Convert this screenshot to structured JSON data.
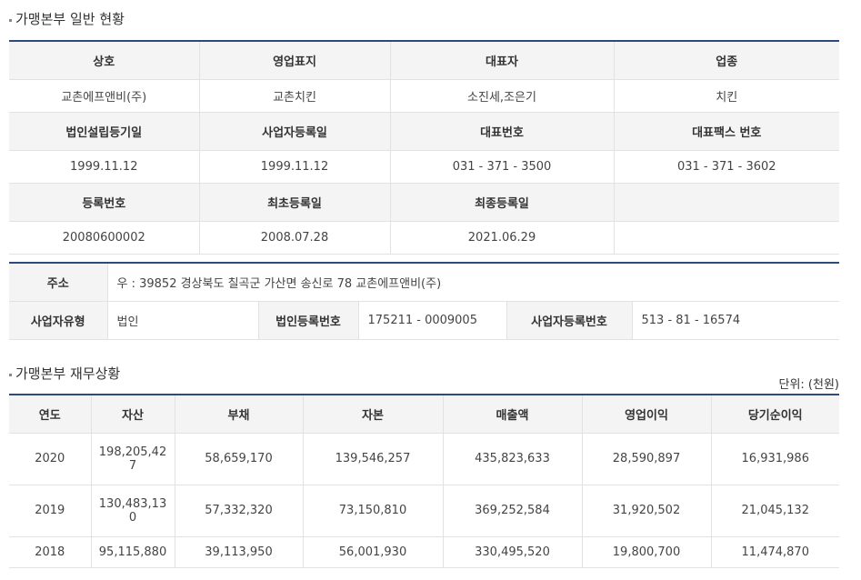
{
  "section1": {
    "title": "가맹본부 일반 현황",
    "row1_headers": [
      "상호",
      "영업표지",
      "대표자",
      "업종"
    ],
    "row1_values": [
      "교촌에프앤비(주)",
      "교촌치킨",
      "소진세,조은기",
      "치킨"
    ],
    "row2_headers": [
      "법인설립등기일",
      "사업자등록일",
      "대표번호",
      "대표팩스 번호"
    ],
    "row2_values": [
      "1999.11.12",
      "1999.11.12",
      "031 - 371 - 3500",
      "031 - 371 - 3602"
    ],
    "row3_headers": [
      "등록번호",
      "최초등록일",
      "최종등록일",
      ""
    ],
    "row3_values": [
      "20080600002",
      "2008.07.28",
      "2021.06.29",
      ""
    ]
  },
  "section2": {
    "address_label": "주소",
    "address_value": "우 : 39852 경상북도 칠곡군 가산면 송신로 78 교촌에프앤비(주)",
    "biztype_label": "사업자유형",
    "biztype_value": "법인",
    "corpno_label": "법인등록번호",
    "corpno_value": "175211 - 0009005",
    "bizno_label": "사업자등록번호",
    "bizno_value": "513 - 81 - 16574"
  },
  "section3": {
    "title": "가맹본부 재무상황",
    "unit": "단위: (천원)",
    "headers": [
      "연도",
      "자산",
      "부채",
      "자본",
      "매출액",
      "영업이익",
      "당기순이익"
    ],
    "rows": [
      [
        "2020",
        "198,205,42\n7",
        "58,659,170",
        "139,546,257",
        "435,823,633",
        "28,590,897",
        "16,931,986"
      ],
      [
        "2019",
        "130,483,13\n0",
        "57,332,320",
        "73,150,810",
        "369,252,584",
        "31,920,502",
        "21,045,132"
      ],
      [
        "2018",
        "95,115,880",
        "39,113,950",
        "56,001,930",
        "330,495,520",
        "19,800,700",
        "11,474,870"
      ]
    ]
  },
  "colors": {
    "accent": "#2c4a7c",
    "header_bg": "#f4f4f4",
    "border": "#e2e2e2"
  }
}
